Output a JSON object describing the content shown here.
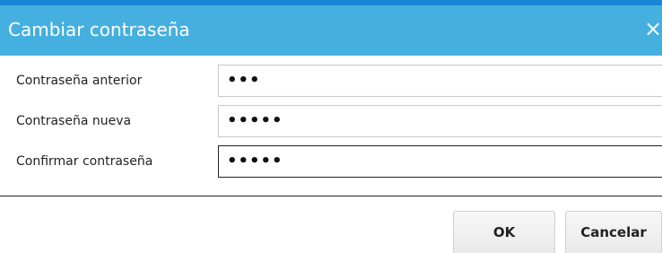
{
  "dialog": {
    "title": "Cambiar contraseña",
    "close_glyph": "×"
  },
  "fields": [
    {
      "label": "Contraseña anterior",
      "value": "•••"
    },
    {
      "label": "Contraseña nueva",
      "value": "•••••"
    },
    {
      "label": "Confirmar contraseña",
      "value": "•••••"
    }
  ],
  "buttons": {
    "ok_label": "OK",
    "cancel_label": "Cancelar"
  },
  "colors": {
    "title_bar": "#45b0e0",
    "top_strip": "#1a86d6",
    "title_text": "#ffffff"
  },
  "icons": {
    "close": "close-icon"
  }
}
